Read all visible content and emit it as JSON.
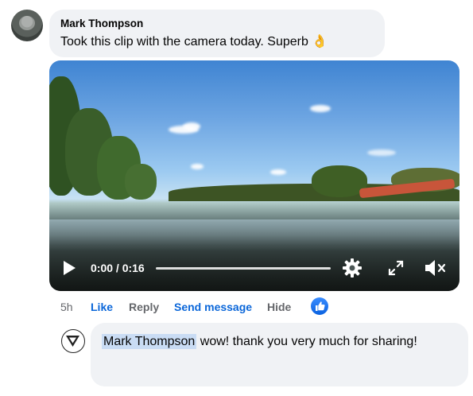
{
  "comment": {
    "author": "Mark Thompson",
    "text": "Took this clip with the camera today. Superb",
    "emoji": "👌",
    "avatar_icon": "profile-photo"
  },
  "video": {
    "time": "0:00 / 0:16",
    "progress": 0,
    "play_icon": "play-icon",
    "settings_icon": "gear-icon",
    "fullscreen_icon": "fullscreen-icon",
    "mute_icon": "muted-speaker-icon"
  },
  "actions": {
    "time_ago": "5h",
    "like": "Like",
    "reply": "Reply",
    "send_message": "Send message",
    "hide": "Hide",
    "reaction_icon": "like-thumb-icon"
  },
  "reply": {
    "mention": "Mark Thompson",
    "text": " wow! thank you very much for sharing!",
    "avatar_icon": "v-logo-avatar"
  },
  "colors": {
    "link_blue": "#0a66d9",
    "bubble_bg": "#f0f2f5",
    "mention_bg": "#c9dcf4"
  }
}
